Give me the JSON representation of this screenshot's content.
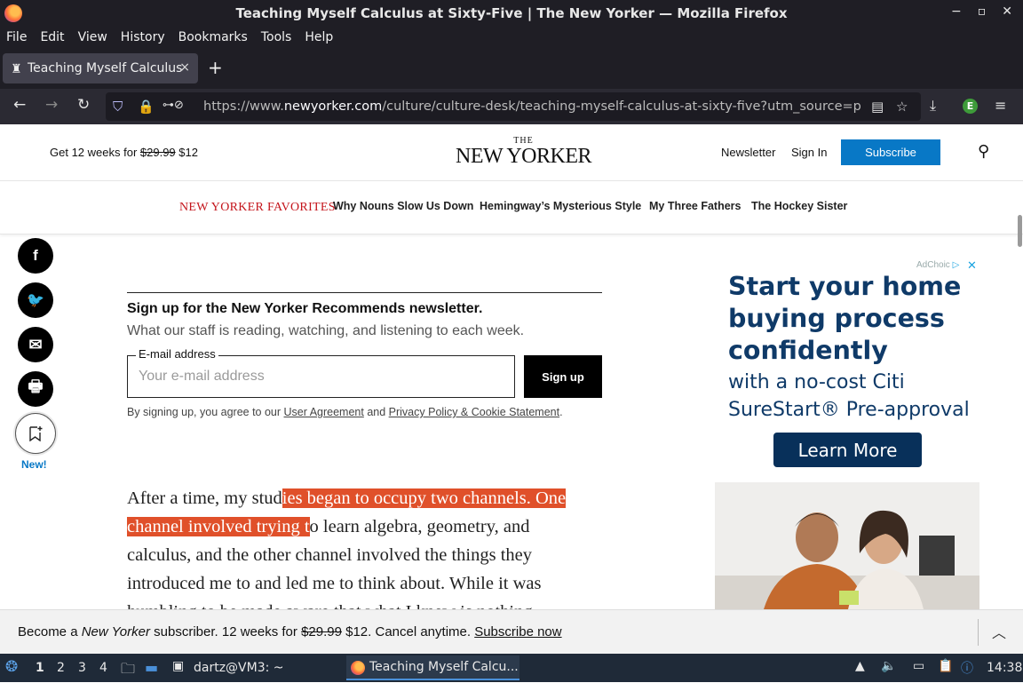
{
  "window": {
    "title": "Teaching Myself Calculus at Sixty-Five | The New Yorker — Mozilla Firefox",
    "controls": [
      "−",
      "▫",
      "✕"
    ]
  },
  "menu": [
    "File",
    "Edit",
    "View",
    "History",
    "Bookmarks",
    "Tools",
    "Help"
  ],
  "tab": {
    "label": "Teaching Myself Calculus",
    "close": "×",
    "new_tab": "+"
  },
  "url": {
    "prefix": "https://www.",
    "domain": "newyorker.com",
    "path": "/culture/culture-desk/teaching-myself-calculus-at-sixty-five?utm_source=pock"
  },
  "header": {
    "promo_prefix": "Get 12 weeks for ",
    "promo_old": "$29.99",
    "promo_new": " $12",
    "logo_the": "THE",
    "logo_name": "NEW YORKER",
    "newsletter": "Newsletter",
    "signin": "Sign In",
    "subscribe": "Subscribe"
  },
  "favorites": {
    "title": "NEW YORKER FAVORITES",
    "links": [
      "Why Nouns Slow Us Down",
      "Hemingway’s Mysterious Style",
      "My Three Fathers",
      "The Hockey Sister"
    ]
  },
  "share": {
    "facebook": "f",
    "twitter": "🐦",
    "email": "✉",
    "print": "🖶",
    "new_label": "New!"
  },
  "newsletter": {
    "title": "Sign up for the New Yorker Recommends newsletter.",
    "subtitle": "What our staff is reading, watching, and listening to each week.",
    "email_label": "E-mail address",
    "placeholder": "Your e-mail address",
    "button": "Sign up",
    "legal_prefix": "By signing up, you agree to our ",
    "legal_link1": "User Agreement",
    "legal_mid": " and ",
    "legal_link2": "Privacy Policy & Cookie Statement",
    "legal_suffix": "."
  },
  "article": {
    "pre": "After a time, my stud",
    "highlight": "ies began to occupy two channels. One channel involved trying t",
    "post": "o learn algebra, geometry, and calculus, and the other channel involved the things they introduced me to and led me to think about. While it was humbling to be made aware that what I knew is nothing"
  },
  "ad": {
    "adchoices": "AdChoic",
    "headline": "Start your home buying process confidently",
    "sub": "with a no-cost Citi SureStart® Pre-approval",
    "button": "Learn More"
  },
  "subscribe_bar": {
    "prefix": "Become a ",
    "brand": "New Yorker",
    "middle": " subscriber. 12 weeks for ",
    "old_price": "$29.99",
    "rest": " $12. Cancel anytime. ",
    "link": "Subscribe now"
  },
  "taskbar": {
    "workspaces": [
      "1",
      "2",
      "3",
      "4"
    ],
    "terminal": "dartz@VM3: ~",
    "task": "Teaching Myself Calcu...",
    "clock": "14:38"
  }
}
